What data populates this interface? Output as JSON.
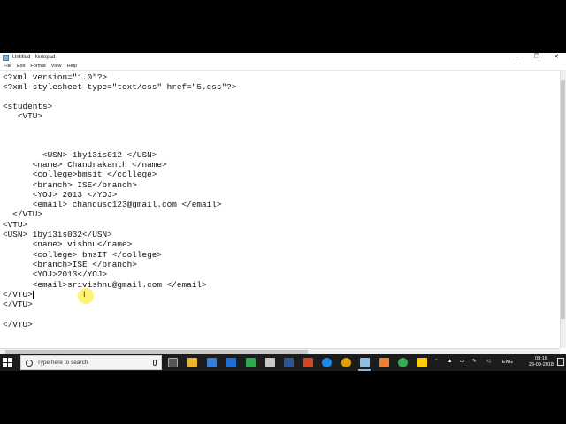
{
  "window": {
    "title": "Untitled - Notepad",
    "minimize_glyph": "–",
    "maximize_glyph": "❐",
    "close_glyph": "✕"
  },
  "menu": [
    "File",
    "Edit",
    "Format",
    "View",
    "Help"
  ],
  "editor": {
    "lines": [
      "<?xml version=\"1.0\"?>",
      "<?xml-stylesheet type=\"text/css\" href=\"5.css\"?>",
      "",
      "<students>",
      "   <VTU>",
      "",
      "",
      "",
      "        <USN> 1by13is012 </USN>",
      "      <name> Chandrakanth </name>",
      "      <college>bmsit </college>",
      "      <branch> ISE</branch>",
      "      <YOJ> 2013 </YOJ>",
      "      <email> chandusc123@gmail.com </email>",
      "  </VTU>",
      "<VTU>",
      "<USN> 1by13is032</USN>",
      "      <name> vishnu</name>",
      "      <college> bmsIT </college>",
      "      <branch>ISE </branch>",
      "      <YOJ>2013</YOJ>",
      "      <email>srivishnu@gmail.com </email>",
      "</VTU>",
      "</VTU>",
      "",
      "</VTU>"
    ]
  },
  "taskbar": {
    "search_placeholder": "Type here to search",
    "language": "ENG",
    "time": "09:16",
    "date": "29-09-2018"
  },
  "colors": {
    "taskbar_bg": "#1c1c1c",
    "cursor_highlight": "#ffe600",
    "active_indicator": "#7ab6e6"
  }
}
